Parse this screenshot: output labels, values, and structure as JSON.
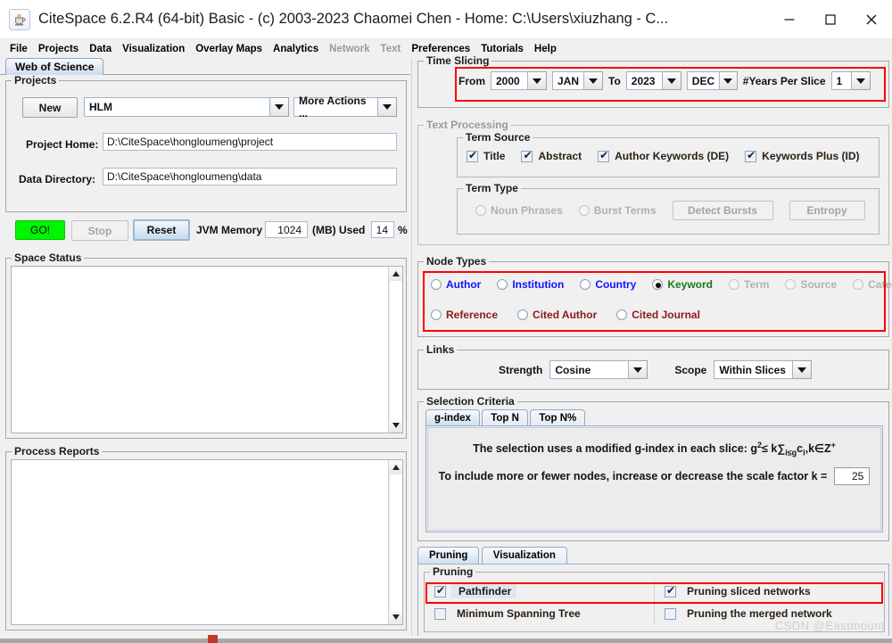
{
  "window": {
    "title": "CiteSpace 6.2.R4 (64-bit) Basic - (c) 2003-2023 Chaomei Chen - Home: C:\\Users\\xiuzhang - C...",
    "app_icon": "java-coffee-cup-icon",
    "minimize": "minimize-icon",
    "maximize": "maximize-icon",
    "close": "close-icon"
  },
  "menubar": {
    "items": [
      {
        "label": "File",
        "enabled": true
      },
      {
        "label": "Projects",
        "enabled": true
      },
      {
        "label": "Data",
        "enabled": true
      },
      {
        "label": "Visualization",
        "enabled": true
      },
      {
        "label": "Overlay Maps",
        "enabled": true
      },
      {
        "label": "Analytics",
        "enabled": true
      },
      {
        "label": "Network",
        "enabled": false
      },
      {
        "label": "Text",
        "enabled": false
      },
      {
        "label": "Preferences",
        "enabled": true
      },
      {
        "label": "Tutorials",
        "enabled": true
      },
      {
        "label": "Help",
        "enabled": true
      }
    ]
  },
  "left": {
    "tab": "Web of Science",
    "projects": {
      "legend": "Projects",
      "new_button": "New",
      "project_combo_value": "HLM",
      "more_actions_value": "More Actions ...",
      "project_home_label": "Project Home:",
      "project_home_value": "D:\\CiteSpace\\hongloumeng\\project",
      "data_directory_label": "Data Directory:",
      "data_directory_value": "D:\\CiteSpace\\hongloumeng\\data"
    },
    "run": {
      "go_label": "GO!",
      "stop_label": "Stop",
      "reset_label": "Reset",
      "jvm_label": "JVM Memory",
      "jvm_value": "1024",
      "mb_used_label": "(MB) Used",
      "used_value": "14",
      "percent_label": "%"
    },
    "space_status_legend": "Space Status",
    "space_status_text": "",
    "process_reports_legend": "Process Reports",
    "process_reports_text": ""
  },
  "right": {
    "time_slicing": {
      "legend": "Time Slicing",
      "from_label": "From",
      "from_year": "2000",
      "from_month": "JAN",
      "to_label": "To",
      "to_year": "2023",
      "to_month": "DEC",
      "years_per_slice_label": "#Years Per Slice",
      "years_per_slice": "1"
    },
    "text_processing": {
      "legend": "Text Processing",
      "enabled": false,
      "term_source": {
        "legend": "Term Source",
        "items": [
          {
            "label": "Title",
            "checked": true
          },
          {
            "label": "Abstract",
            "checked": true
          },
          {
            "label": "Author Keywords (DE)",
            "checked": true
          },
          {
            "label": "Keywords Plus (ID)",
            "checked": true
          }
        ]
      },
      "term_type": {
        "legend": "Term Type",
        "radios": [
          {
            "label": "Noun Phrases",
            "selected": false
          },
          {
            "label": "Burst Terms",
            "selected": false
          }
        ],
        "detect_bursts": "Detect Bursts",
        "entropy": "Entropy"
      }
    },
    "node_types": {
      "legend": "Node Types",
      "row1": [
        {
          "label": "Author",
          "selected": false,
          "color": "#1414ff",
          "enabled": true
        },
        {
          "label": "Institution",
          "selected": false,
          "color": "#1414ff",
          "enabled": true
        },
        {
          "label": "Country",
          "selected": false,
          "color": "#1414ff",
          "enabled": true
        },
        {
          "label": "Keyword",
          "selected": true,
          "color": "#1a7a1a",
          "enabled": true
        },
        {
          "label": "Term",
          "selected": false,
          "color": "#b0b0b0",
          "enabled": false
        },
        {
          "label": "Source",
          "selected": false,
          "color": "#b0b0b0",
          "enabled": false
        },
        {
          "label": "Category",
          "selected": false,
          "color": "#b0b0b0",
          "enabled": false
        }
      ],
      "row2": [
        {
          "label": "Reference",
          "selected": false,
          "color": "#8b1a1a",
          "enabled": true
        },
        {
          "label": "Cited Author",
          "selected": false,
          "color": "#8b1a1a",
          "enabled": true
        },
        {
          "label": "Cited Journal",
          "selected": false,
          "color": "#8b1a1a",
          "enabled": true
        }
      ]
    },
    "links": {
      "legend": "Links",
      "strength_label": "Strength",
      "strength_value": "Cosine",
      "scope_label": "Scope",
      "scope_value": "Within Slices"
    },
    "selection_criteria": {
      "legend": "Selection Criteria",
      "tabs": [
        {
          "label": "g-index",
          "active": true
        },
        {
          "label": "Top N",
          "active": false
        },
        {
          "label": "Top N%",
          "active": false
        }
      ],
      "line1_pre": "The selection uses a modified g-index in each slice: g",
      "line1_sup": "2",
      "line1_mid": "≤ k∑",
      "line1_sub": "i≤g",
      "line1_post": "c",
      "line1_sub2": "i",
      "line1_tail": ",k∈Z",
      "line1_sup2": "+",
      "line2": "To include more or fewer nodes, increase or decrease the scale factor k =",
      "k_value": "25"
    },
    "bottom_tabs": [
      {
        "label": "Pruning",
        "active": true
      },
      {
        "label": "Visualization",
        "active": false
      }
    ],
    "pruning": {
      "legend": "Pruning",
      "items": [
        {
          "label": "Pathfinder",
          "checked": true,
          "highlighted": true
        },
        {
          "label": "Pruning sliced networks",
          "checked": true,
          "highlighted": false
        },
        {
          "label": "Minimum Spanning Tree",
          "checked": false,
          "highlighted": false
        },
        {
          "label": "Pruning the merged network",
          "checked": false,
          "highlighted": false
        }
      ]
    }
  },
  "watermark": "CSDN @Eastmount",
  "colors": {
    "accent_red": "#ff0000",
    "go_green": "#00f500",
    "panel_bg": "#f0f0f0"
  }
}
